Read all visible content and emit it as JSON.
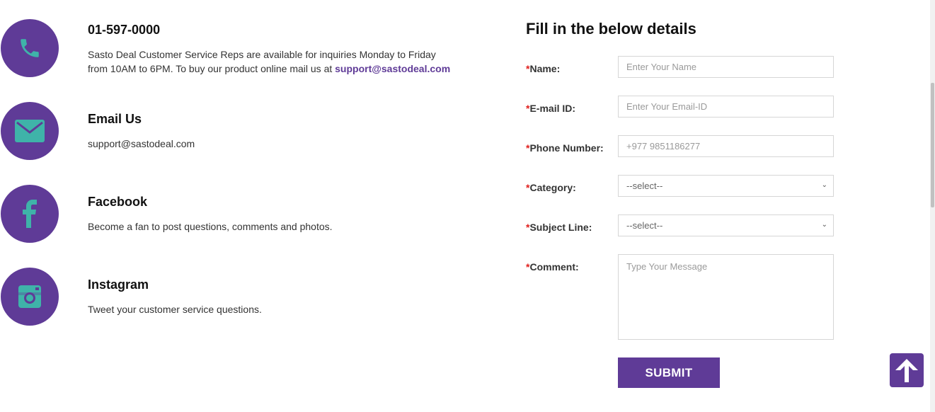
{
  "contacts": [
    {
      "icon": "phone-icon",
      "title": "01-597-0000",
      "desc_line1": "Sasto Deal Customer Service Reps are available for inquiries Monday to Friday",
      "desc_line2_prefix": "from 10AM to 6PM. To buy our product online mail us at ",
      "desc_link": "support@sastodeal.com"
    },
    {
      "icon": "envelope-icon",
      "title": "Email Us",
      "desc": "support@sastodeal.com"
    },
    {
      "icon": "facebook-icon",
      "title": "Facebook",
      "desc": "Become a fan to post questions, comments and photos."
    },
    {
      "icon": "instagram-icon",
      "title": "Instagram",
      "desc": "Tweet your customer service questions."
    }
  ],
  "form": {
    "title": "Fill in the below details",
    "required_mark": "*",
    "name": {
      "label": "Name:",
      "placeholder": "Enter Your Name"
    },
    "email": {
      "label": "E-mail ID:",
      "placeholder": "Enter Your Email-ID"
    },
    "phone": {
      "label": "Phone Number:",
      "placeholder": "+977 9851186277"
    },
    "category": {
      "label": "Category:",
      "selected": "--select--"
    },
    "subject": {
      "label": "Subject Line:",
      "selected": "--select--"
    },
    "comment": {
      "label": "Comment:",
      "placeholder": "Type Your Message"
    },
    "submit_label": "SUBMIT"
  },
  "colors": {
    "brand": "#5f3b97",
    "icon_teal": "#3fb3a9",
    "required": "#e0201e"
  },
  "back_to_top_icon": "arrow-up-icon"
}
